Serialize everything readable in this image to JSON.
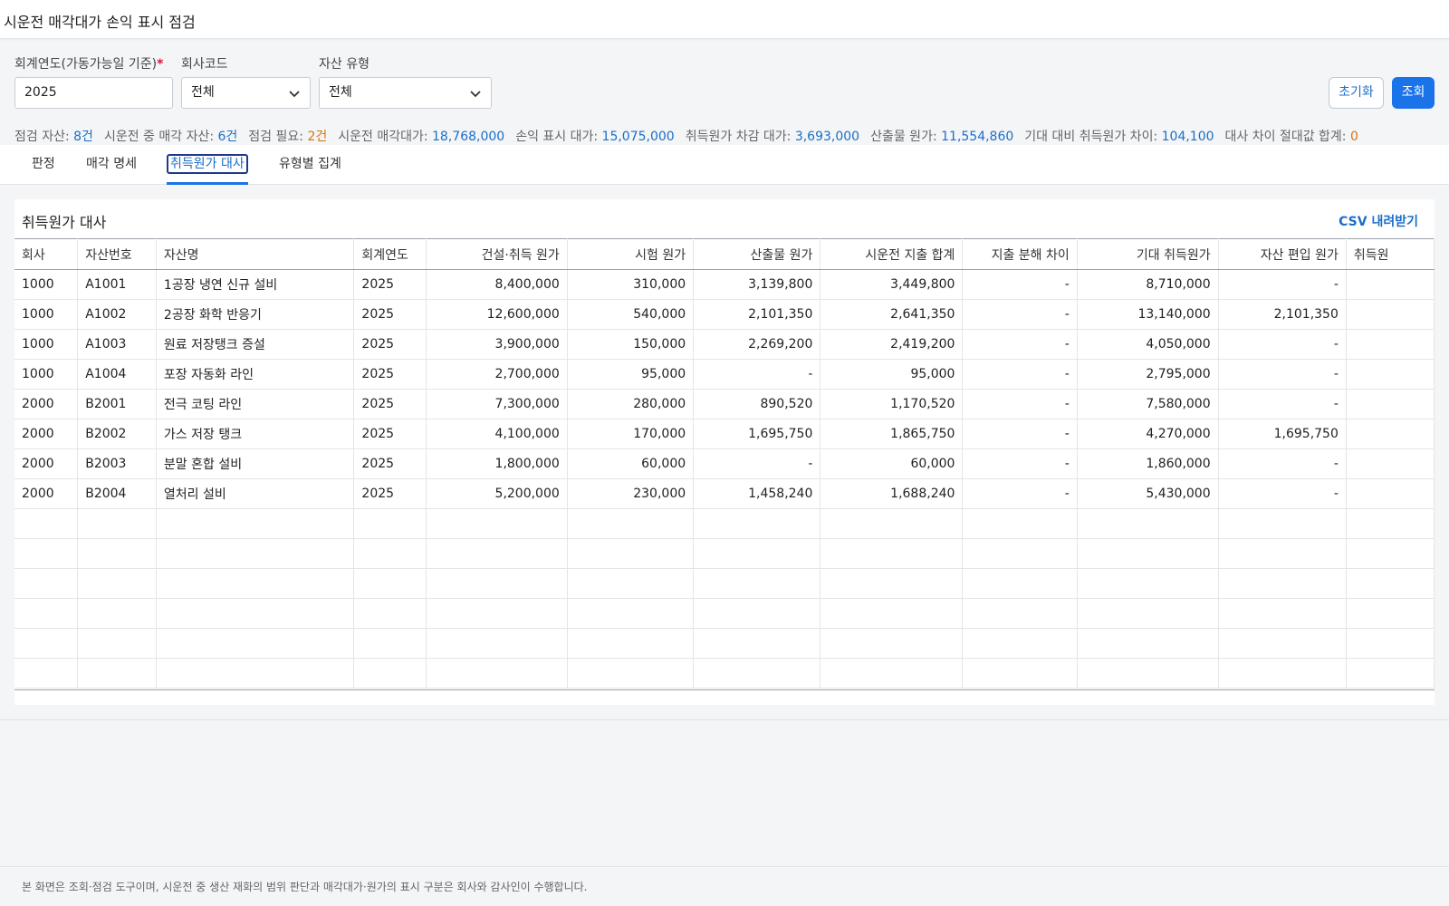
{
  "window": {
    "title": "시운전 매각대가 손익 표시 점검"
  },
  "filters": {
    "fiscal_year_label": "회계연도(가동가능일 기준)",
    "required_mark": "*",
    "fiscal_year_value": "2025",
    "company_label": "회사코드",
    "company_value": "전체",
    "asset_type_label": "자산 유형",
    "asset_type_value": "전체",
    "reset_label": "초기화",
    "query_label": "조회"
  },
  "summary": [
    {
      "label": "점검 자산: ",
      "value": "8건",
      "tone": "blue"
    },
    {
      "label": "시운전 중 매각 자산: ",
      "value": "6건",
      "tone": "blue"
    },
    {
      "label": "점검 필요: ",
      "value": "2건",
      "tone": "orange"
    },
    {
      "label": "시운전 매각대가: ",
      "value": "18,768,000",
      "tone": "blue"
    },
    {
      "label": "손익 표시 대가: ",
      "value": "15,075,000",
      "tone": "blue"
    },
    {
      "label": "취득원가 차감 대가: ",
      "value": "3,693,000",
      "tone": "blue"
    },
    {
      "label": "산출물 원가: ",
      "value": "11,554,860",
      "tone": "blue"
    },
    {
      "label": "기대 대비 취득원가 차이: ",
      "value": "104,100",
      "tone": "blue"
    },
    {
      "label": "대사 차이 절대값 합계: ",
      "value": "0",
      "tone": "orange"
    }
  ],
  "tabs": [
    {
      "label": "판정"
    },
    {
      "label": "매각 명세"
    },
    {
      "label": "취득원가 대사",
      "active": true
    },
    {
      "label": "유형별 집계"
    }
  ],
  "panel": {
    "title": "취득원가 대사",
    "csv_label": "CSV 내려받기"
  },
  "table": {
    "columns": [
      "회사",
      "자산번호",
      "자산명",
      "회계연도",
      "건설·취득 원가",
      "시험 원가",
      "산출물 원가",
      "시운전 지출 합계",
      "지출 분해 차이",
      "기대 취득원가",
      "자산 편입 원가",
      "취득원"
    ],
    "rows": [
      [
        "1000",
        "A1001",
        "1공장 냉연 신규 설비",
        "2025",
        "8,400,000",
        "310,000",
        "3,139,800",
        "3,449,800",
        "-",
        "8,710,000",
        "-",
        ""
      ],
      [
        "1000",
        "A1002",
        "2공장 화학 반응기",
        "2025",
        "12,600,000",
        "540,000",
        "2,101,350",
        "2,641,350",
        "-",
        "13,140,000",
        "2,101,350",
        ""
      ],
      [
        "1000",
        "A1003",
        "원료 저장탱크 증설",
        "2025",
        "3,900,000",
        "150,000",
        "2,269,200",
        "2,419,200",
        "-",
        "4,050,000",
        "-",
        ""
      ],
      [
        "1000",
        "A1004",
        "포장 자동화 라인",
        "2025",
        "2,700,000",
        "95,000",
        "-",
        "95,000",
        "-",
        "2,795,000",
        "-",
        ""
      ],
      [
        "2000",
        "B2001",
        "전극 코팅 라인",
        "2025",
        "7,300,000",
        "280,000",
        "890,520",
        "1,170,520",
        "-",
        "7,580,000",
        "-",
        ""
      ],
      [
        "2000",
        "B2002",
        "가스 저장 탱크",
        "2025",
        "4,100,000",
        "170,000",
        "1,695,750",
        "1,865,750",
        "-",
        "4,270,000",
        "1,695,750",
        ""
      ],
      [
        "2000",
        "B2003",
        "분말 혼합 설비",
        "2025",
        "1,800,000",
        "60,000",
        "-",
        "60,000",
        "-",
        "1,860,000",
        "-",
        ""
      ],
      [
        "2000",
        "B2004",
        "열처리 설비",
        "2025",
        "5,200,000",
        "230,000",
        "1,458,240",
        "1,688,240",
        "-",
        "5,430,000",
        "-",
        ""
      ]
    ],
    "empty_rows": 6
  },
  "footer": {
    "note": "본 화면은 조회·점검 도구이며, 시운전 중 생산 재화의 범위 판단과 매각대가·원가의 표시 구분은 회사와 감사인이 수행합니다."
  },
  "colors": {
    "accent": "#1a73e8",
    "link": "#1a6fc9",
    "warn": "#d9720b",
    "required": "#d0193b"
  },
  "icons": {
    "select_arrow": "chevron-down-icon"
  }
}
